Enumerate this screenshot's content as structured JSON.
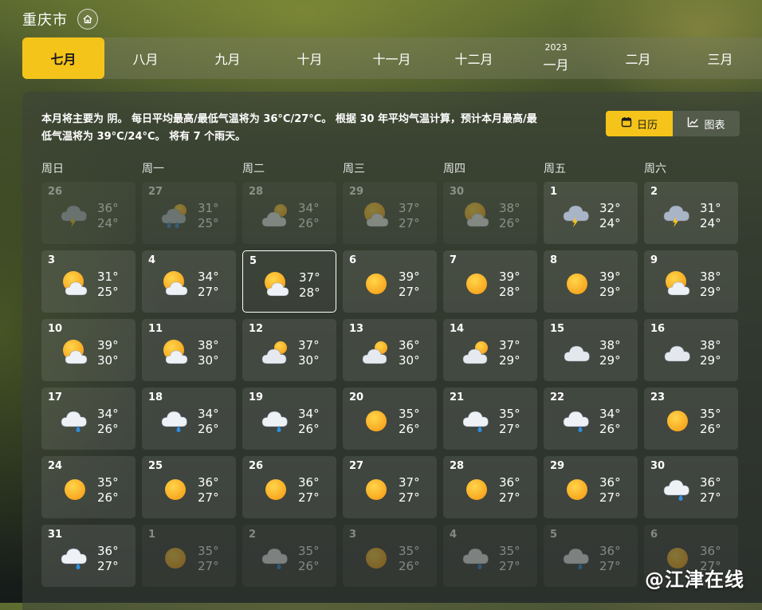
{
  "location": {
    "city": "重庆市",
    "home_icon": "home-icon"
  },
  "month_tabs": [
    {
      "label": "七月",
      "active": true
    },
    {
      "label": "八月"
    },
    {
      "label": "九月"
    },
    {
      "label": "十月"
    },
    {
      "label": "十一月"
    },
    {
      "label": "十二月"
    },
    {
      "label": "一月",
      "year": "2023"
    },
    {
      "label": "二月"
    },
    {
      "label": "三月"
    }
  ],
  "summary": "本月将主要为 阴。 每日平均最高/最低气温将为 36°C/27°C。 根据 30 年平均气温计算，预计本月最高/最低气温将为 39°C/24°C。 将有 7 个雨天。",
  "view_toggle": {
    "calendar_label": "日历",
    "chart_label": "图表",
    "selected": "calendar"
  },
  "weekdays": [
    "周日",
    "周一",
    "周二",
    "周三",
    "周四",
    "周五",
    "周六"
  ],
  "days": [
    {
      "day": "26",
      "hi": "36°",
      "lo": "24°",
      "icon": "storm",
      "dim": true
    },
    {
      "day": "27",
      "hi": "31°",
      "lo": "25°",
      "icon": "sun-rain",
      "dim": true
    },
    {
      "day": "28",
      "hi": "34°",
      "lo": "26°",
      "icon": "cloud-sun",
      "dim": true
    },
    {
      "day": "29",
      "hi": "37°",
      "lo": "27°",
      "icon": "sun-cloud",
      "dim": true
    },
    {
      "day": "30",
      "hi": "38°",
      "lo": "26°",
      "icon": "sun-cloud",
      "dim": true
    },
    {
      "day": "1",
      "hi": "32°",
      "lo": "24°",
      "icon": "storm"
    },
    {
      "day": "2",
      "hi": "31°",
      "lo": "24°",
      "icon": "storm"
    },
    {
      "day": "3",
      "hi": "31°",
      "lo": "25°",
      "icon": "sun-cloud"
    },
    {
      "day": "4",
      "hi": "34°",
      "lo": "27°",
      "icon": "sun-cloud"
    },
    {
      "day": "5",
      "hi": "37°",
      "lo": "28°",
      "icon": "sun-cloud",
      "today": true
    },
    {
      "day": "6",
      "hi": "39°",
      "lo": "27°",
      "icon": "sun"
    },
    {
      "day": "7",
      "hi": "39°",
      "lo": "28°",
      "icon": "sun"
    },
    {
      "day": "8",
      "hi": "39°",
      "lo": "29°",
      "icon": "sun"
    },
    {
      "day": "9",
      "hi": "38°",
      "lo": "29°",
      "icon": "sun-cloud"
    },
    {
      "day": "10",
      "hi": "39°",
      "lo": "30°",
      "icon": "sun-cloud"
    },
    {
      "day": "11",
      "hi": "38°",
      "lo": "30°",
      "icon": "sun-cloud"
    },
    {
      "day": "12",
      "hi": "37°",
      "lo": "30°",
      "icon": "cloud-sun"
    },
    {
      "day": "13",
      "hi": "36°",
      "lo": "30°",
      "icon": "cloud-sun"
    },
    {
      "day": "14",
      "hi": "37°",
      "lo": "29°",
      "icon": "cloud-sun"
    },
    {
      "day": "15",
      "hi": "38°",
      "lo": "29°",
      "icon": "cloud"
    },
    {
      "day": "16",
      "hi": "38°",
      "lo": "29°",
      "icon": "cloud"
    },
    {
      "day": "17",
      "hi": "34°",
      "lo": "26°",
      "icon": "rain"
    },
    {
      "day": "18",
      "hi": "34°",
      "lo": "26°",
      "icon": "rain"
    },
    {
      "day": "19",
      "hi": "34°",
      "lo": "26°",
      "icon": "rain"
    },
    {
      "day": "20",
      "hi": "35°",
      "lo": "26°",
      "icon": "sun"
    },
    {
      "day": "21",
      "hi": "35°",
      "lo": "27°",
      "icon": "rain"
    },
    {
      "day": "22",
      "hi": "34°",
      "lo": "26°",
      "icon": "rain"
    },
    {
      "day": "23",
      "hi": "35°",
      "lo": "26°",
      "icon": "sun"
    },
    {
      "day": "24",
      "hi": "35°",
      "lo": "26°",
      "icon": "sun"
    },
    {
      "day": "25",
      "hi": "36°",
      "lo": "27°",
      "icon": "sun"
    },
    {
      "day": "26",
      "hi": "36°",
      "lo": "27°",
      "icon": "sun"
    },
    {
      "day": "27",
      "hi": "37°",
      "lo": "27°",
      "icon": "sun"
    },
    {
      "day": "28",
      "hi": "36°",
      "lo": "27°",
      "icon": "sun"
    },
    {
      "day": "29",
      "hi": "36°",
      "lo": "27°",
      "icon": "sun"
    },
    {
      "day": "30",
      "hi": "36°",
      "lo": "27°",
      "icon": "rain"
    },
    {
      "day": "31",
      "hi": "36°",
      "lo": "27°",
      "icon": "rain"
    },
    {
      "day": "1",
      "hi": "35°",
      "lo": "27°",
      "icon": "sun",
      "dim": true
    },
    {
      "day": "2",
      "hi": "35°",
      "lo": "26°",
      "icon": "rain",
      "dim": true
    },
    {
      "day": "3",
      "hi": "35°",
      "lo": "26°",
      "icon": "sun",
      "dim": true
    },
    {
      "day": "4",
      "hi": "35°",
      "lo": "27°",
      "icon": "rain",
      "dim": true
    },
    {
      "day": "5",
      "hi": "36°",
      "lo": "27°",
      "icon": "rain",
      "dim": true
    },
    {
      "day": "6",
      "hi": "36°",
      "lo": "27°",
      "icon": "sun",
      "dim": true
    }
  ],
  "watermark": "@江津在线",
  "colors": {
    "accent": "#f5c41a",
    "sun": "#f7a21b",
    "rain": "#2f8fe0",
    "lightning": "#f5c41a"
  }
}
